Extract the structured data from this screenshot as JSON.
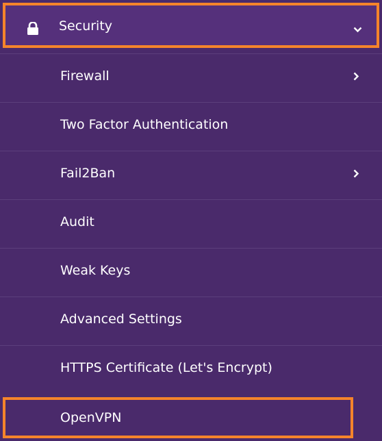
{
  "menu": {
    "header": {
      "label": "Security",
      "icon": "lock-icon",
      "expand_icon": "chevron-down-icon"
    },
    "items": [
      {
        "label": "Firewall",
        "has_submenu": true
      },
      {
        "label": "Two Factor Authentication",
        "has_submenu": false
      },
      {
        "label": "Fail2Ban",
        "has_submenu": true
      },
      {
        "label": "Audit",
        "has_submenu": false
      },
      {
        "label": "Weak Keys",
        "has_submenu": false
      },
      {
        "label": "Advanced Settings",
        "has_submenu": false
      },
      {
        "label": "HTTPS Certificate (Let's Encrypt)",
        "has_submenu": false
      },
      {
        "label": "OpenVPN",
        "has_submenu": false
      }
    ]
  },
  "colors": {
    "menu_background": "#4a2a6b",
    "header_background": "#55307b",
    "highlight_border": "#f5842b",
    "text": "#ffffff"
  }
}
